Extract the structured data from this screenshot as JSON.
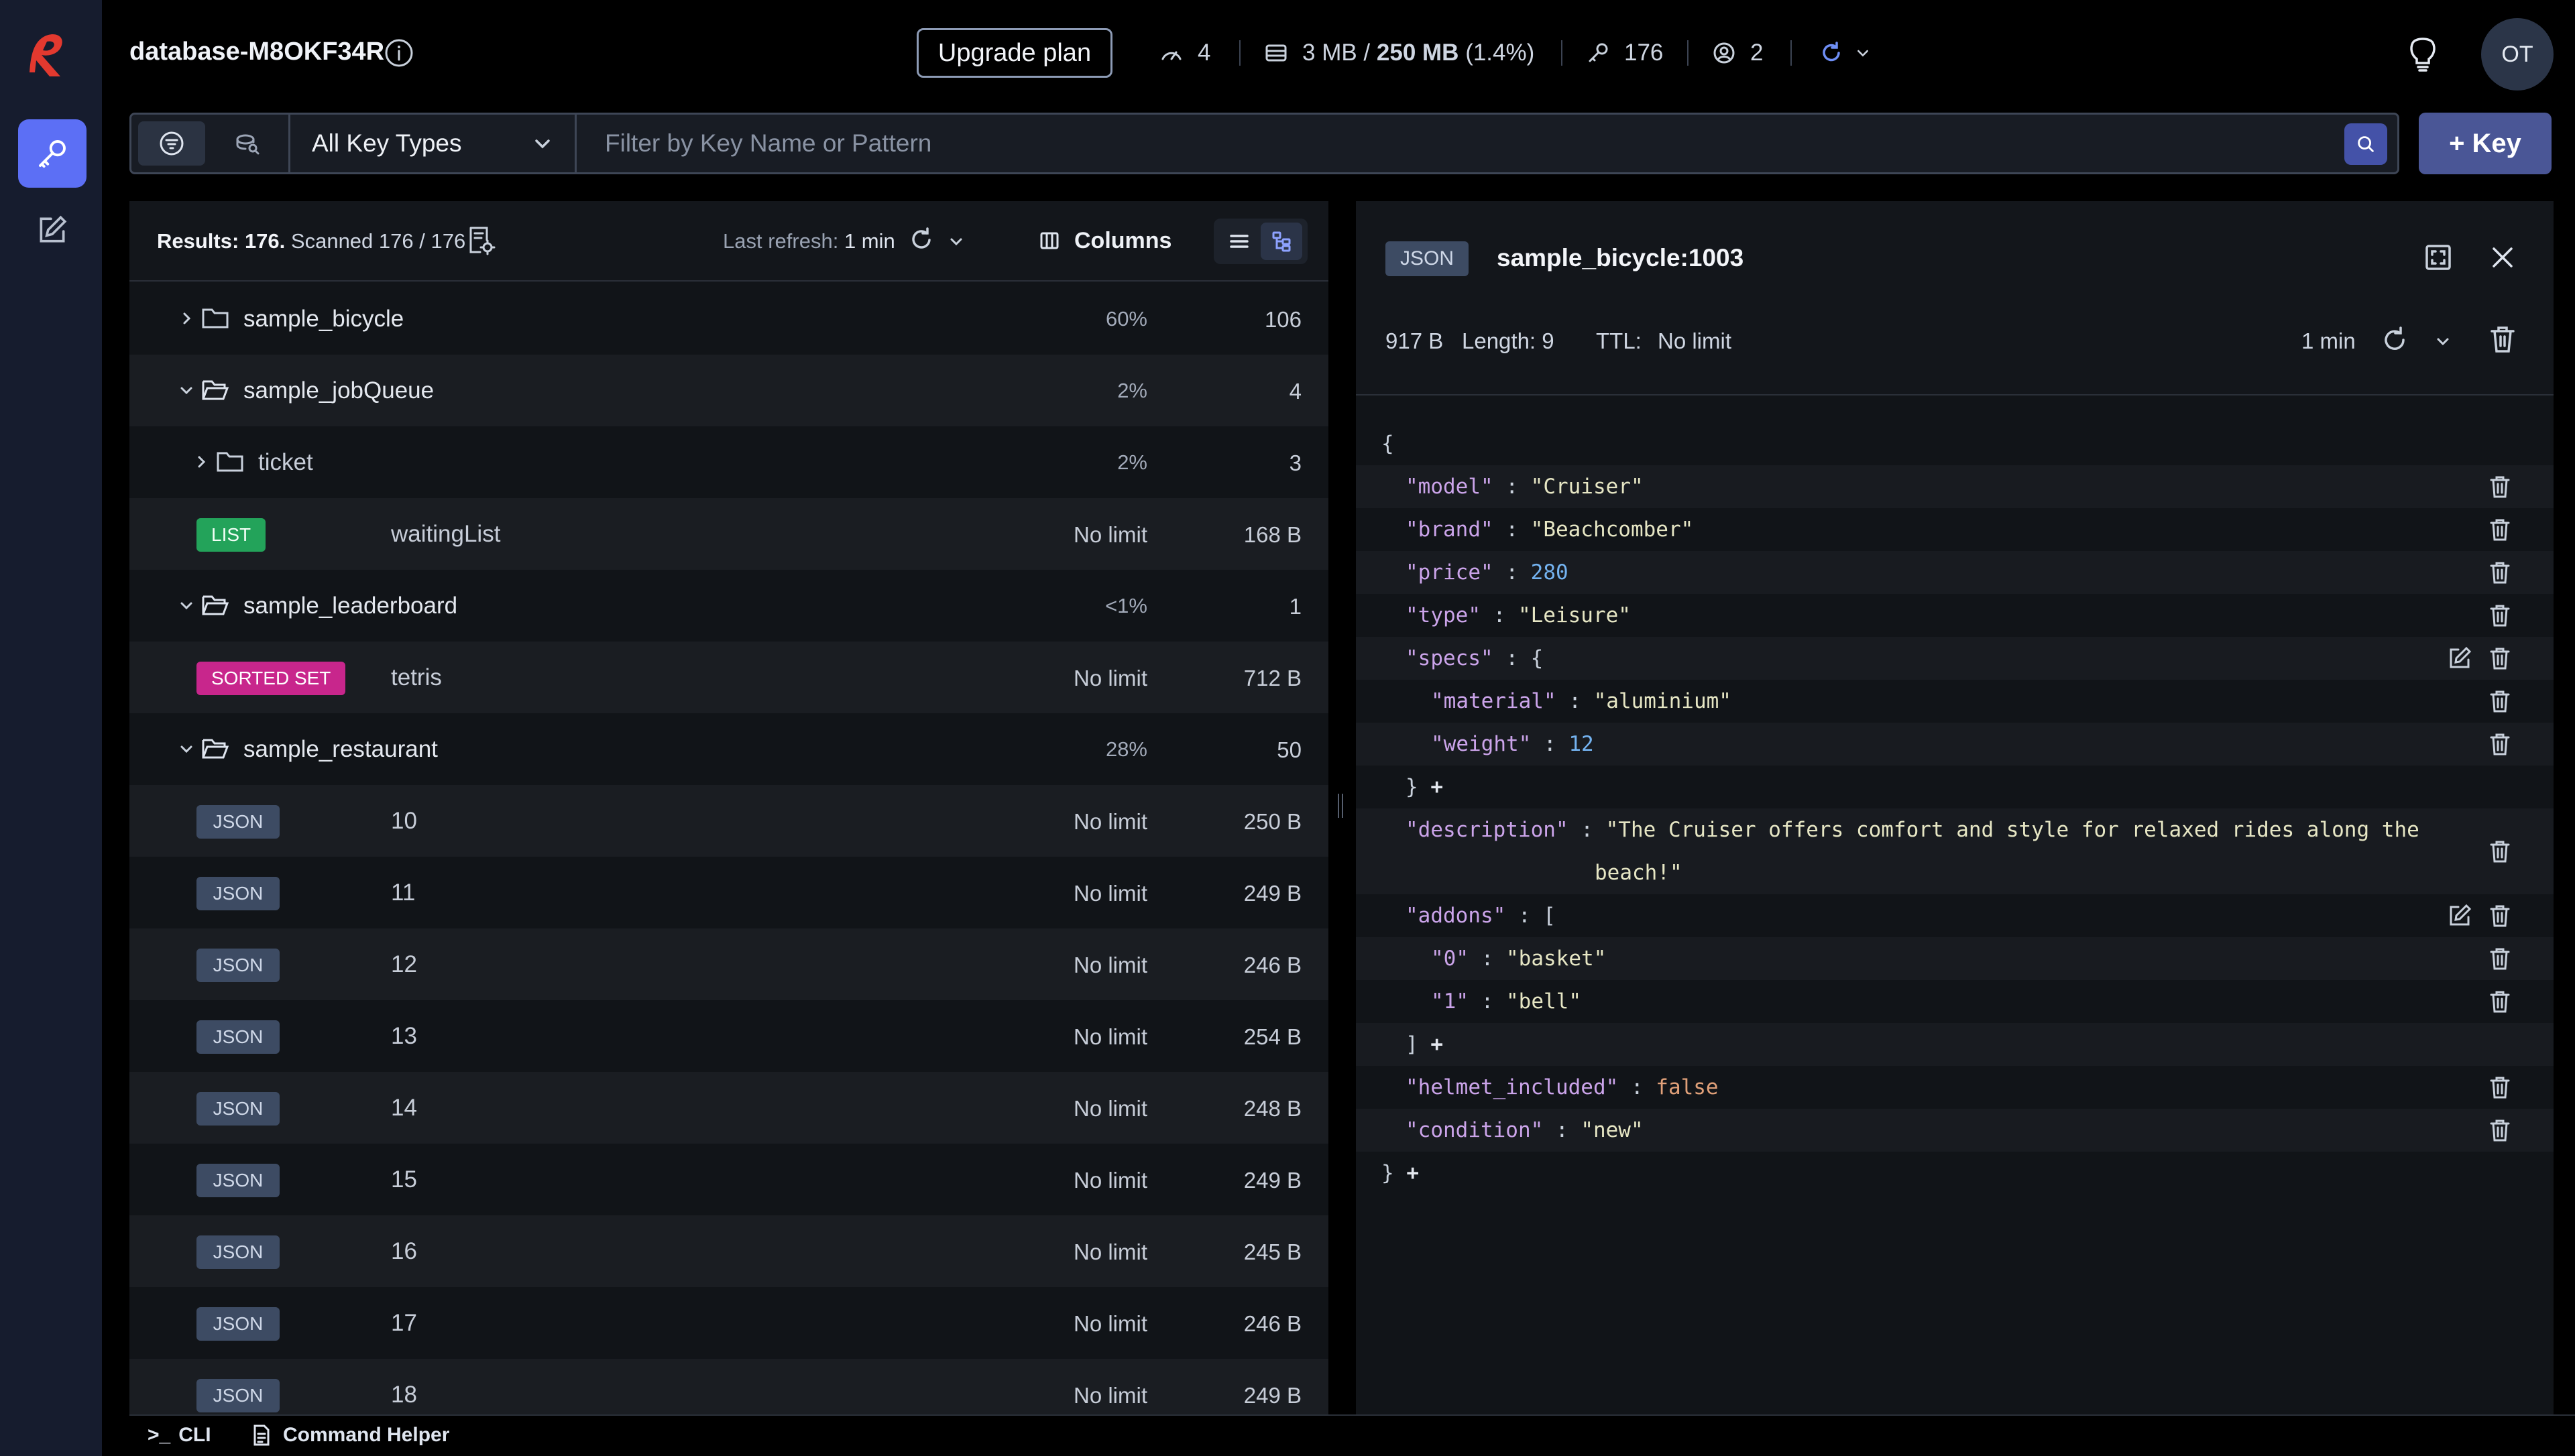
{
  "header": {
    "db_name": "database-M8OKF34R",
    "upgrade_label": "Upgrade plan",
    "stats": {
      "connected_clients": "4",
      "memory_used": "3 MB",
      "memory_total": "250 MB",
      "memory_percent": "(1.4%)",
      "total_keys": "176",
      "cpu": "2"
    },
    "avatar_initials": "OT"
  },
  "filter": {
    "key_type_selected": "All Key Types",
    "search_placeholder": "Filter by Key Name or Pattern",
    "add_key_label": "+ Key"
  },
  "list": {
    "results_label": "Results:",
    "results_count": "176.",
    "scanned_label": "Scanned 176 / 176",
    "last_refresh_label": "Last refresh:",
    "last_refresh_value": "1 min",
    "columns_label": "Columns",
    "rows": [
      {
        "kind": "folder",
        "name": "sample_bicycle",
        "pct": "60%",
        "count": "106",
        "expanded": false
      },
      {
        "kind": "folder",
        "name": "sample_jobQueue",
        "pct": "2%",
        "count": "4",
        "expanded": true
      },
      {
        "kind": "folder",
        "name": "ticket",
        "pct": "2%",
        "count": "3",
        "expanded": false
      },
      {
        "kind": "key",
        "type": "LIST",
        "name": "waitingList",
        "ttl": "No limit",
        "size": "168 B"
      },
      {
        "kind": "folder",
        "name": "sample_leaderboard",
        "pct": "<1%",
        "count": "1",
        "expanded": true
      },
      {
        "kind": "key",
        "type": "SORTED SET",
        "name": "tetris",
        "ttl": "No limit",
        "size": "712 B"
      },
      {
        "kind": "folder",
        "name": "sample_restaurant",
        "pct": "28%",
        "count": "50",
        "expanded": true
      },
      {
        "kind": "key",
        "type": "JSON",
        "name": "10",
        "ttl": "No limit",
        "size": "250 B"
      },
      {
        "kind": "key",
        "type": "JSON",
        "name": "11",
        "ttl": "No limit",
        "size": "249 B"
      },
      {
        "kind": "key",
        "type": "JSON",
        "name": "12",
        "ttl": "No limit",
        "size": "246 B"
      },
      {
        "kind": "key",
        "type": "JSON",
        "name": "13",
        "ttl": "No limit",
        "size": "254 B"
      },
      {
        "kind": "key",
        "type": "JSON",
        "name": "14",
        "ttl": "No limit",
        "size": "248 B"
      },
      {
        "kind": "key",
        "type": "JSON",
        "name": "15",
        "ttl": "No limit",
        "size": "249 B"
      },
      {
        "kind": "key",
        "type": "JSON",
        "name": "16",
        "ttl": "No limit",
        "size": "245 B"
      },
      {
        "kind": "key",
        "type": "JSON",
        "name": "17",
        "ttl": "No limit",
        "size": "246 B"
      },
      {
        "kind": "key",
        "type": "JSON",
        "name": "18",
        "ttl": "No limit",
        "size": "249 B"
      }
    ]
  },
  "details": {
    "type": "JSON",
    "key_name": "sample_bicycle:1003",
    "size": "917 B",
    "length_label": "Length: 9",
    "ttl_label": "TTL:",
    "ttl_value": "No limit",
    "refreshed": "1 min",
    "json": {
      "model": "\"Cruiser\"",
      "brand": "\"Beachcomber\"",
      "price": "280",
      "type": "\"Leisure\"",
      "material": "\"aluminium\"",
      "weight": "12",
      "description_1": "\"The Cruiser offers comfort and style for relaxed rides along the",
      "description_2": "beach!\"",
      "addon_0": "\"basket\"",
      "addon_1": "\"bell\"",
      "helmet_included": "false",
      "condition": "\"new\""
    }
  },
  "bottom": {
    "cli_label": "CLI",
    "helper_label": "Command Helper"
  },
  "colors": {
    "accent": "#5c6ff5",
    "list_badge": "#23a35a",
    "zset_badge": "#c8268c",
    "json_badge": "#3d4b63",
    "logo_red": "#e3392f"
  }
}
